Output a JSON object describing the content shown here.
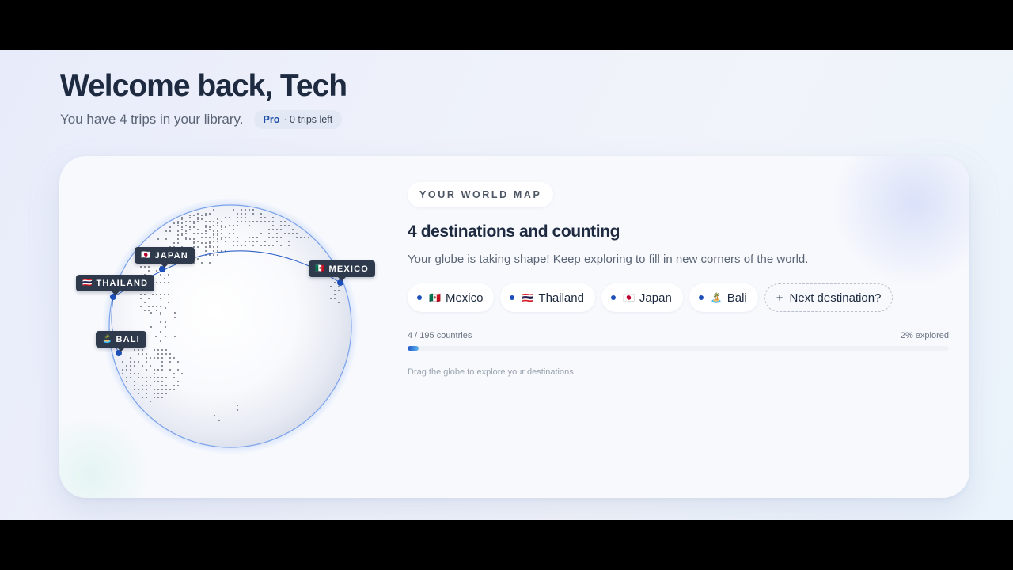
{
  "header": {
    "welcome_title": "Welcome back, Tech",
    "library_text": "You have 4 trips in your library.",
    "plan_name": "Pro",
    "plan_detail": "· 0 trips left"
  },
  "world_map": {
    "section_label": "YOUR WORLD MAP",
    "heading": "4 destinations and counting",
    "description": "Your globe is taking shape! Keep exploring to fill in new corners of the world.",
    "destinations": [
      {
        "name": "Mexico",
        "flag": "🇲🇽"
      },
      {
        "name": "Thailand",
        "flag": "🇹🇭"
      },
      {
        "name": "Japan",
        "flag": "🇯🇵"
      },
      {
        "name": "Bali",
        "flag": "🏝️"
      }
    ],
    "add_destination_label": "Next destination?",
    "add_icon": "+",
    "progress_count_text": "4 / 195 countries",
    "progress_percent_text": "2% explored",
    "progress_fraction": 0.021,
    "drag_hint": "Drag the globe to explore your destinations"
  },
  "globe": {
    "pins": [
      {
        "label": "JAPAN",
        "flag": "🇯🇵"
      },
      {
        "label": "THAILAND",
        "flag": "🇹🇭"
      },
      {
        "label": "MEXICO",
        "flag": "🇲🇽"
      },
      {
        "label": "BALI",
        "flag": "🏝️"
      }
    ]
  },
  "colors": {
    "accent": "#1d4fb8",
    "heading": "#1d2a3f",
    "pin_label_bg": "#2e3a4c"
  }
}
